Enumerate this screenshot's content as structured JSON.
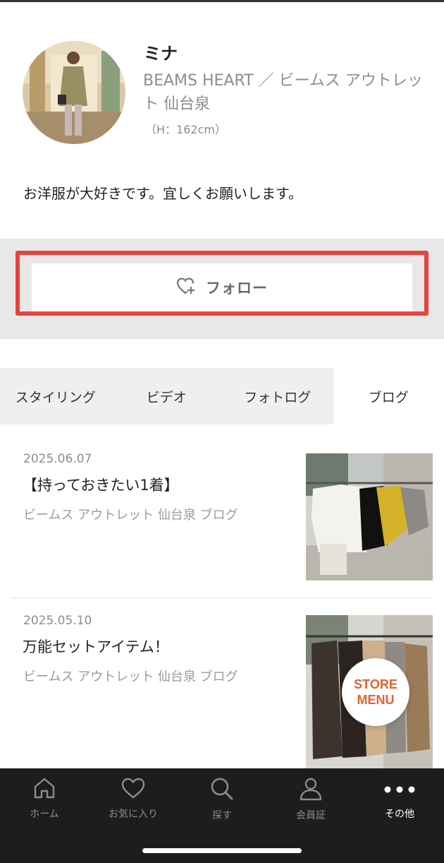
{
  "profile": {
    "name": "ミナ",
    "shop": "BEAMS HEART ／ ビームス アウトレット 仙台泉",
    "height": "（H：162cm）",
    "bio": "お洋服が大好きです。宜しくお願いします。"
  },
  "follow": {
    "label": "フォロー",
    "icon": "heart-plus-icon"
  },
  "tabs": [
    {
      "label": "スタイリング",
      "active": false
    },
    {
      "label": "ビデオ",
      "active": false
    },
    {
      "label": "フォトログ",
      "active": false
    },
    {
      "label": "ブログ",
      "active": true
    }
  ],
  "blog_items": [
    {
      "date": "2025.06.07",
      "title": "【持っておきたい1着】",
      "shop": "ビームス アウトレット 仙台泉 ブログ"
    },
    {
      "date": "2025.05.10",
      "title": "万能セットアイテム！",
      "shop": "ビームス アウトレット 仙台泉 ブログ"
    }
  ],
  "store_menu": {
    "line1": "STORE",
    "line2": "MENU",
    "color": "#e1632f"
  },
  "bottom_nav": [
    {
      "label": "ホーム",
      "icon": "home-icon",
      "active": false
    },
    {
      "label": "お気に入り",
      "icon": "heart-icon",
      "active": false
    },
    {
      "label": "探す",
      "icon": "search-icon",
      "active": false
    },
    {
      "label": "会員証",
      "icon": "person-icon",
      "active": false
    },
    {
      "label": "その他",
      "icon": "more-icon",
      "active": true
    }
  ],
  "colors": {
    "highlight": "#e5443f",
    "nav_bg": "#1d1d1d",
    "tab_bg": "#efefef"
  }
}
